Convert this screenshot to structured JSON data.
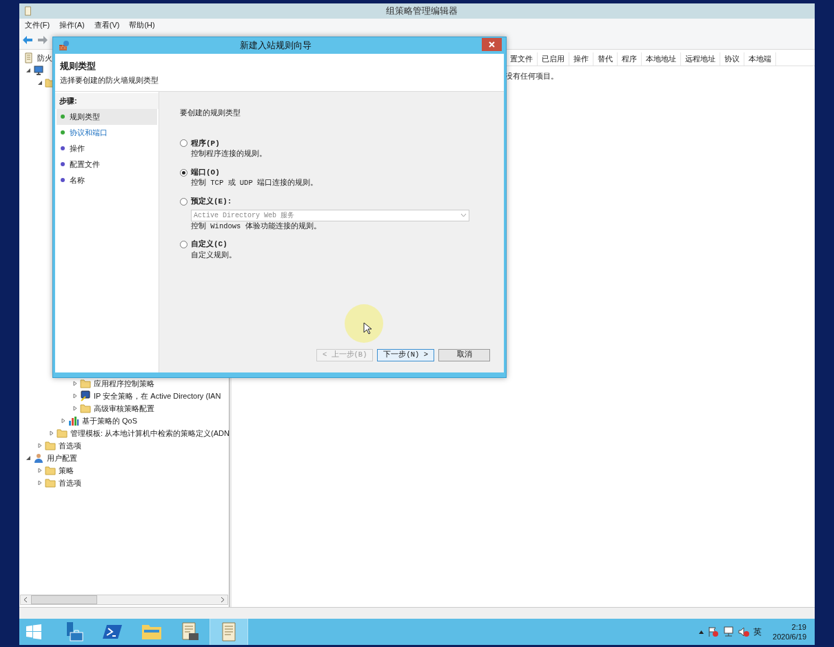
{
  "window": {
    "title": "组策略管理编辑器"
  },
  "menu": [
    "文件(F)",
    "操作(A)",
    "查看(V)",
    "帮助(H)"
  ],
  "tree": [
    {
      "label": "防火",
      "kind": "document",
      "children": [
        {
          "kind": "computer",
          "expanded": true,
          "children": [
            {
              "kind": "folder",
              "expanded": true,
              "children": [
                {
                  "children": [
                    {
                      "children": [
                        {
                          "label": "应用程序控制策略",
                          "kind": "folder",
                          "expanded": false
                        },
                        {
                          "label": "IP 安全策略，在 Active Directory (IAN",
                          "kind": "shield",
                          "expanded": false
                        },
                        {
                          "label": "高级审核策略配置",
                          "kind": "folder",
                          "expanded": false
                        }
                      ]
                    },
                    {
                      "label": "基于策略的 QoS",
                      "kind": "chart",
                      "expanded": false
                    }
                  ]
                },
                {
                  "label": "管理模板: 从本地计算机中检索的策略定义(ADN",
                  "kind": "folder",
                  "expanded": false
                }
              ]
            },
            {
              "label": "首选项",
              "kind": "folder",
              "expanded": false
            }
          ]
        },
        {
          "label": "用户配置",
          "kind": "user",
          "expanded": true,
          "children": [
            {
              "label": "策略",
              "kind": "folder",
              "expanded": false
            },
            {
              "label": "首选项",
              "kind": "folder",
              "expanded": false
            }
          ]
        }
      ]
    }
  ],
  "list": {
    "columns": [
      "置文件",
      "已启用",
      "操作",
      "替代",
      "程序",
      "本地地址",
      "远程地址",
      "协议",
      "本地端"
    ],
    "empty_text": "没有任何项目。"
  },
  "dialog": {
    "title": "新建入站规则向导",
    "heading": "规则类型",
    "subheading": "选择要创建的防火墙规则类型",
    "steps_title": "步骤:",
    "steps": [
      {
        "label": "规则类型",
        "selected": true,
        "hovered": false,
        "color": "#3aa83a"
      },
      {
        "label": "协议和端口",
        "selected": false,
        "hovered": true,
        "color": "#3aa83a"
      },
      {
        "label": "操作",
        "selected": false,
        "hovered": false,
        "color": "#5b50c8"
      },
      {
        "label": "配置文件",
        "selected": false,
        "hovered": false,
        "color": "#5b50c8"
      },
      {
        "label": "名称",
        "selected": false,
        "hovered": false,
        "color": "#5b50c8"
      }
    ],
    "prompt": "要创建的规则类型",
    "options": [
      {
        "label": "程序(P)",
        "description": "控制程序连接的规则。",
        "selected": false
      },
      {
        "label": "端口(O)",
        "description": "控制 TCP 或 UDP 端口连接的规则。",
        "selected": true
      },
      {
        "label": "预定义(E):",
        "select": {
          "value": "Active Directory Web 服务",
          "disabled": true
        },
        "description": "控制 Windows 体验功能连接的规则。",
        "selected": false
      },
      {
        "label": "自定义(C)",
        "description": "自定义规则。",
        "selected": false
      }
    ],
    "buttons": [
      {
        "label": "< 上一步(B)",
        "disabled": true,
        "default": false
      },
      {
        "label": "下一步(N) >",
        "disabled": false,
        "default": true
      },
      {
        "label": "取消",
        "disabled": false,
        "default": false
      }
    ]
  },
  "taskbar": {
    "apps": [
      {
        "kind": "server-manager",
        "selected": false
      },
      {
        "kind": "powershell",
        "selected": false
      },
      {
        "kind": "explorer",
        "selected": false
      },
      {
        "kind": "policy-editor",
        "selected": false
      },
      {
        "kind": "notepad",
        "selected": true
      }
    ],
    "tray": {
      "language": "英",
      "time": "2:19",
      "date": "2020/6/19"
    }
  }
}
